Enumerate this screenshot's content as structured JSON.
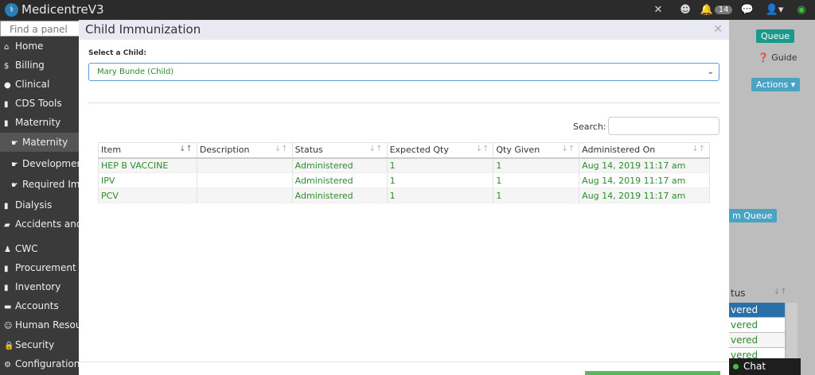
{
  "app": {
    "name": "MedicentreV3"
  },
  "topbar": {
    "notifications_count": "14"
  },
  "sidebar": {
    "search_placeholder": "Find a panel",
    "items": [
      {
        "label": "Home",
        "icon": "home-icon"
      },
      {
        "label": "Billing",
        "icon": "dollar-icon"
      },
      {
        "label": "Clinical",
        "icon": "user-icon"
      },
      {
        "label": "CDS Tools",
        "icon": "clipboard-icon"
      },
      {
        "label": "Maternity",
        "icon": "clipboard-icon"
      },
      {
        "label": "Maternity",
        "icon": "hand-icon"
      },
      {
        "label": "Development",
        "icon": "hand-icon"
      },
      {
        "label": "Required Imm",
        "icon": "hand-icon"
      },
      {
        "label": "Dialysis",
        "icon": "clipboard-icon"
      },
      {
        "label": "Accidents and",
        "icon": "truck-icon"
      },
      {
        "label": "CWC",
        "icon": "child-icon"
      },
      {
        "label": "Procurement",
        "icon": "clipboard-icon"
      },
      {
        "label": "Inventory",
        "icon": "clipboard-icon"
      },
      {
        "label": "Accounts",
        "icon": "book-icon"
      },
      {
        "label": "Human Resour",
        "icon": "users-icon"
      },
      {
        "label": "Security",
        "icon": "lock-icon"
      },
      {
        "label": "Configuration",
        "icon": "gears-icon"
      }
    ]
  },
  "background": {
    "queue_label": "Queue",
    "guide_label": "Guide",
    "actions_label": "Actions",
    "queue2_label": "m Queue",
    "status_header": "tus",
    "rows": [
      "vered",
      "vered",
      "vered",
      "vered"
    ]
  },
  "modal": {
    "title": "Child Immunization",
    "select_label": "Select a Child:",
    "selected_child": "Mary Bunde (Child)",
    "search_label": "Search:",
    "search_value": "",
    "columns": [
      "Item",
      "Description",
      "Status",
      "Expected Qty",
      "Qty Given",
      "Administered On"
    ],
    "rows": [
      {
        "item": "HEP B VACCINE",
        "description": "",
        "status": "Administered",
        "expected_qty": "1",
        "qty_given": "1",
        "administered_on": "Aug 14, 2019 11:17 am"
      },
      {
        "item": "IPV",
        "description": "",
        "status": "Administered",
        "expected_qty": "1",
        "qty_given": "1",
        "administered_on": "Aug 14, 2019 11:17 am"
      },
      {
        "item": "PCV",
        "description": "",
        "status": "Administered",
        "expected_qty": "1",
        "qty_given": "1",
        "administered_on": "Aug 14, 2019 11:17 am"
      }
    ]
  },
  "chat": {
    "label": "Chat"
  }
}
